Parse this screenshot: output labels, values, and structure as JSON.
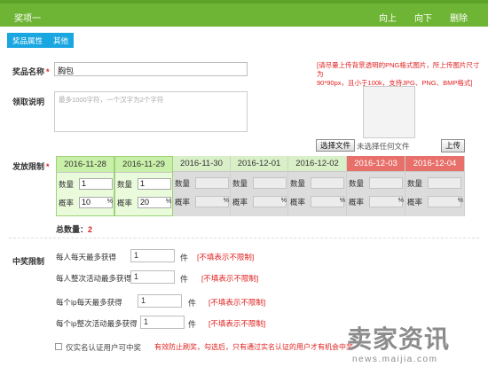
{
  "header": {
    "title": "奖项一",
    "actions": [
      "向上",
      "向下",
      "删除"
    ]
  },
  "tabs": [
    "奖品属性",
    "其他"
  ],
  "prize_name": {
    "label": "奖品名称",
    "required_mark": "*",
    "value": "胸包"
  },
  "claim_desc": {
    "label": "领取说明",
    "placeholder": "最多1000字符，一个汉字为2个字符"
  },
  "upload": {
    "tip": [
      "[请尽量上传背景透明的PNG格式图片，所上传图片尺寸为",
      "90*90px，且小于100k，支持JPG、PNG、BMP格式]"
    ],
    "choose_label": "选择文件",
    "file_status": "未选择任何文件",
    "upload_label": "上传"
  },
  "issue_limit": {
    "label": "发放限制",
    "required_mark": "*",
    "qty_label": "数量",
    "rate_label": "概率",
    "pct": "%",
    "columns": [
      {
        "date": "2016-11-28",
        "state": "active",
        "qty": "1",
        "rate": "10"
      },
      {
        "date": "2016-11-29",
        "state": "active",
        "qty": "1",
        "rate": "20"
      },
      {
        "date": "2016-11-30",
        "state": "normal",
        "qty": "",
        "rate": ""
      },
      {
        "date": "2016-12-01",
        "state": "normal",
        "qty": "",
        "rate": ""
      },
      {
        "date": "2016-12-02",
        "state": "normal",
        "qty": "",
        "rate": ""
      },
      {
        "date": "2016-12-03",
        "state": "weekend",
        "qty": "",
        "rate": ""
      },
      {
        "date": "2016-12-04",
        "state": "weekend",
        "qty": "",
        "rate": ""
      }
    ],
    "total_label": "总数量：",
    "total_value": "2"
  },
  "win_limit": {
    "label": "中奖限制",
    "rows": [
      {
        "text": "每人每天最多获得",
        "value": "1",
        "unit": "件",
        "note": "[不填表示不限制]"
      },
      {
        "text": "每人整次活动最多获得",
        "value": "1",
        "unit": "件",
        "note": "[不填表示不限制]"
      },
      {
        "text": "每个ip每天最多获得",
        "value": "1",
        "unit": "件",
        "note": "[不填表示不限制]"
      },
      {
        "text": "每个ip整次活动最多获得",
        "value": "1",
        "unit": "件",
        "note": "[不填表示不限制]"
      }
    ],
    "realname_label": "仅实名认证用户可中奖",
    "realname_note": "有效防止刷奖，勾选后，只有通过实名认证的用户才有机会中奖"
  },
  "colors": {
    "green": "#6fb535",
    "blue": "#1aa6e0",
    "active_head": "#c9f0a8",
    "weekend_head": "#e8706a",
    "normal_head": "#d9efc8",
    "red": "#e02020"
  },
  "watermark": {
    "big": "卖家资讯",
    "small": "news.maijia.com"
  }
}
